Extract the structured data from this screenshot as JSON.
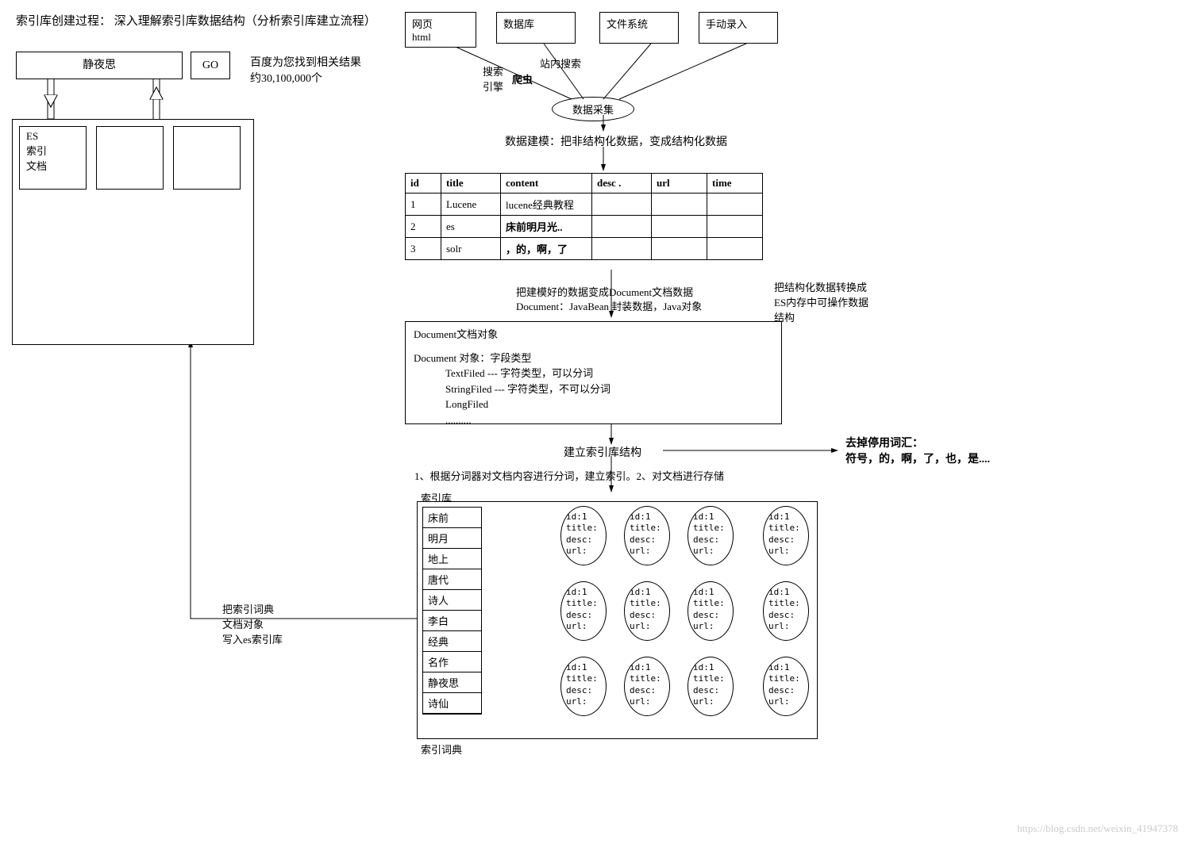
{
  "title": "索引库创建过程： 深入理解索引库数据结构（分析索引库建立流程）",
  "search": {
    "value": "静夜思",
    "btn": "GO",
    "result_line1": "百度为您找到相关结果",
    "result_line2": "约30,100,000个"
  },
  "es_box": "ES\n索引\n文档",
  "sources": {
    "a": "网页\nhtml",
    "b": "数据库",
    "c": "文件系统",
    "d": "手动录入",
    "funnel_l": "搜索\n引擎",
    "funnel_b": "爬虫",
    "funnel_r": "站内搜索",
    "collect": "数据采集"
  },
  "modeling": "数据建模：把非结构化数据，变成结构化数据",
  "table": {
    "headers": [
      "id",
      "title",
      "content",
      "desc .",
      "url",
      "time"
    ],
    "rows": [
      [
        "1",
        "Lucene",
        "lucene经典教程",
        "",
        "",
        ""
      ],
      [
        "2",
        "es",
        "床前明月光..",
        "",
        "",
        ""
      ],
      [
        "3",
        "solr",
        "，的，啊，了",
        "",
        "",
        ""
      ]
    ]
  },
  "row2_bold": "床前明月光..",
  "row3_bold": "，的，啊，了",
  "doc_note1": "把建模好的数据变成Document文档数据",
  "doc_note2": "Document：JavaBean 封装数据，Java对象",
  "convert_note": "把结构化数据转换成\nES内存中可操作数据\n结构",
  "doc_box": {
    "title": "Document文档对象",
    "l1": "Document 对象：字段类型",
    "l2": "TextFiled  --- 字符类型，可以分词",
    "l3": "StringFiled --- 字符类型，不可以分词",
    "l4": "LongFiled",
    "l5": ".........."
  },
  "index_build": "建立索引库结构",
  "stopwords": "去掉停用词汇：\n符号，的，啊，了，也，是....",
  "step": "1、根据分词器对文档内容进行分词，建立索引。2、对文档进行存储",
  "index_lib": "索引库",
  "dict": {
    "title": "索引词典",
    "items": [
      "床前",
      "明月",
      "地上",
      "唐代",
      "诗人",
      "李白",
      "经典",
      "名作",
      "静夜思",
      "诗仙"
    ]
  },
  "write_note": "把索引词典\n文档对象\n写入es索引库",
  "doc_fields": "id:1\ntitle:\ndesc:\nurl:",
  "watermark": "https://blog.csdn.net/weixin_41947378"
}
